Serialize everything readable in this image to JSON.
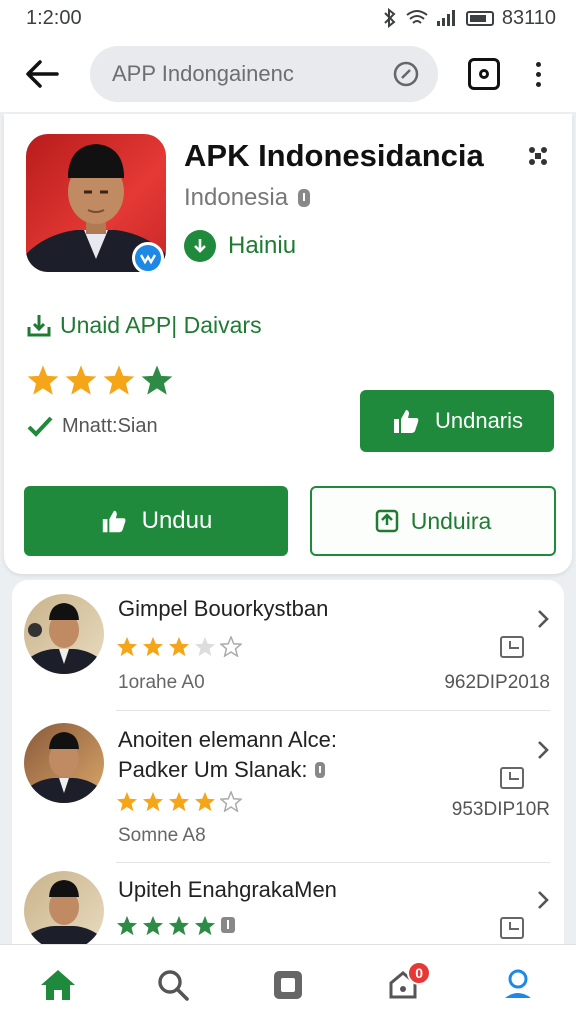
{
  "status_bar": {
    "time": "1:2:00",
    "right_text": "83110"
  },
  "search": {
    "value": "APP Indongainenc"
  },
  "app": {
    "title": "APK Indonesidancia",
    "subtitle": "Indonesia",
    "developer": "Hainiu",
    "tagline": "Unaid  APP| Daivars",
    "rating": 4,
    "verified_label": "Mnatt:Sian",
    "button_right": "Undnaris",
    "button_primary": "Unduu",
    "button_secondary": "Unduira"
  },
  "list": [
    {
      "title": "Gimpel Bouorkystban",
      "title2": "",
      "stars": 3,
      "meta": "1orahe A0",
      "code": "962DIP2018"
    },
    {
      "title": "Anoiten elemann Alce:",
      "title2": "Padker Um Slanak:",
      "stars": 4,
      "meta": "Somne A8",
      "code": "953DIP10R"
    },
    {
      "title": "Upiteh EnahgrakaMen",
      "title2": "",
      "stars": 4,
      "meta": "",
      "code": ""
    }
  ],
  "colors": {
    "primary": "#1f8a3b",
    "star": "#f4a518",
    "star_green": "#2e8b46"
  },
  "bottom_nav": {
    "badge_count": "0",
    "icons": [
      "home-icon",
      "search-icon",
      "apps-icon",
      "notifications-icon",
      "account-icon"
    ]
  }
}
